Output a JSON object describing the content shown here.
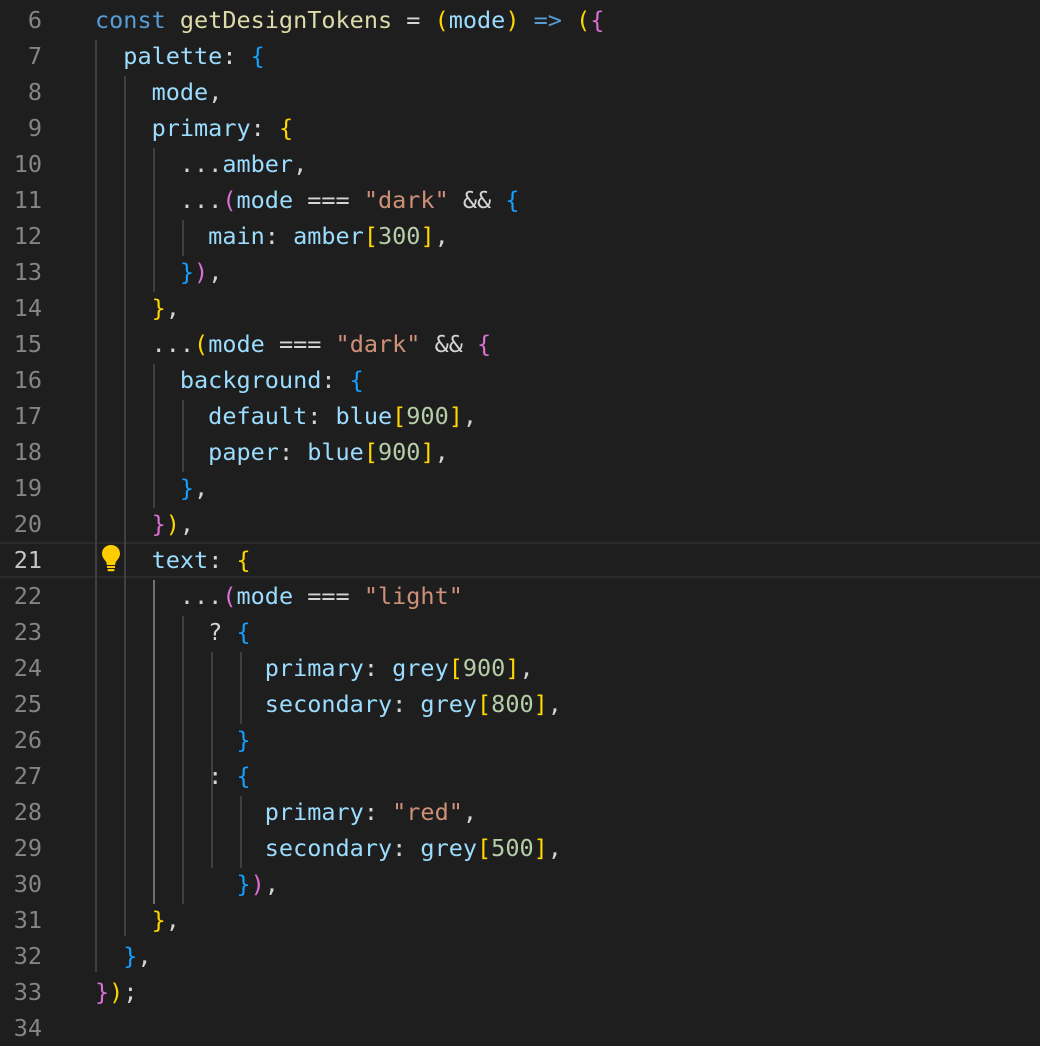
{
  "editor": {
    "current_line": 21,
    "lightbulb_icon": "lightbulb-icon",
    "lines": [
      {
        "n": "6",
        "t": [
          [
            "const ",
            "kw"
          ],
          [
            "getDesignTokens",
            "fn"
          ],
          [
            " = ",
            "op"
          ],
          [
            "(",
            "b1"
          ],
          [
            "mode",
            "var"
          ],
          [
            ")",
            "b1"
          ],
          [
            " => ",
            "kw"
          ],
          [
            "(",
            "b1"
          ],
          [
            "{",
            "b2"
          ]
        ]
      },
      {
        "n": "7",
        "t": [
          [
            "  palette",
            "var"
          ],
          [
            ": ",
            "op"
          ],
          [
            "{",
            "b3"
          ]
        ]
      },
      {
        "n": "8",
        "t": [
          [
            "    mode",
            "var"
          ],
          [
            ",",
            "op"
          ]
        ]
      },
      {
        "n": "9",
        "t": [
          [
            "    primary",
            "var"
          ],
          [
            ": ",
            "op"
          ],
          [
            "{",
            "b1"
          ]
        ]
      },
      {
        "n": "10",
        "t": [
          [
            "      ...",
            "op"
          ],
          [
            "amber",
            "var"
          ],
          [
            ",",
            "op"
          ]
        ]
      },
      {
        "n": "11",
        "t": [
          [
            "      ...",
            "op"
          ],
          [
            "(",
            "b2"
          ],
          [
            "mode",
            "var"
          ],
          [
            " === ",
            "op"
          ],
          [
            "\"dark\"",
            "str"
          ],
          [
            " && ",
            "op"
          ],
          [
            "{",
            "b3"
          ]
        ]
      },
      {
        "n": "12",
        "t": [
          [
            "        main",
            "var"
          ],
          [
            ": ",
            "op"
          ],
          [
            "amber",
            "var"
          ],
          [
            "[",
            "b1"
          ],
          [
            "300",
            "num"
          ],
          [
            "]",
            "b1"
          ],
          [
            ",",
            "op"
          ]
        ]
      },
      {
        "n": "13",
        "t": [
          [
            "      ",
            "op"
          ],
          [
            "}",
            "b3"
          ],
          [
            ")",
            "b2"
          ],
          [
            ",",
            "op"
          ]
        ]
      },
      {
        "n": "14",
        "t": [
          [
            "    ",
            "op"
          ],
          [
            "}",
            "b1"
          ],
          [
            ",",
            "op"
          ]
        ]
      },
      {
        "n": "15",
        "t": [
          [
            "    ...",
            "op"
          ],
          [
            "(",
            "b1"
          ],
          [
            "mode",
            "var"
          ],
          [
            " === ",
            "op"
          ],
          [
            "\"dark\"",
            "str"
          ],
          [
            " && ",
            "op"
          ],
          [
            "{",
            "b2"
          ]
        ]
      },
      {
        "n": "16",
        "t": [
          [
            "      background",
            "var"
          ],
          [
            ": ",
            "op"
          ],
          [
            "{",
            "b3"
          ]
        ]
      },
      {
        "n": "17",
        "t": [
          [
            "        default",
            "var"
          ],
          [
            ": ",
            "op"
          ],
          [
            "blue",
            "var"
          ],
          [
            "[",
            "b1"
          ],
          [
            "900",
            "num"
          ],
          [
            "]",
            "b1"
          ],
          [
            ",",
            "op"
          ]
        ]
      },
      {
        "n": "18",
        "t": [
          [
            "        paper",
            "var"
          ],
          [
            ": ",
            "op"
          ],
          [
            "blue",
            "var"
          ],
          [
            "[",
            "b1"
          ],
          [
            "900",
            "num"
          ],
          [
            "]",
            "b1"
          ],
          [
            ",",
            "op"
          ]
        ]
      },
      {
        "n": "19",
        "t": [
          [
            "      ",
            "op"
          ],
          [
            "}",
            "b3"
          ],
          [
            ",",
            "op"
          ]
        ]
      },
      {
        "n": "20",
        "t": [
          [
            "    ",
            "op"
          ],
          [
            "}",
            "b2"
          ],
          [
            ")",
            "b1"
          ],
          [
            ",",
            "op"
          ]
        ]
      },
      {
        "n": "21",
        "t": [
          [
            "    text",
            "var"
          ],
          [
            ": ",
            "op"
          ],
          [
            "{",
            "b1"
          ]
        ]
      },
      {
        "n": "22",
        "t": [
          [
            "      ...",
            "op"
          ],
          [
            "(",
            "b2"
          ],
          [
            "mode",
            "var"
          ],
          [
            " === ",
            "op"
          ],
          [
            "\"light\"",
            "str"
          ]
        ]
      },
      {
        "n": "23",
        "t": [
          [
            "        ? ",
            "op"
          ],
          [
            "{",
            "b3"
          ]
        ]
      },
      {
        "n": "24",
        "t": [
          [
            "            primary",
            "var"
          ],
          [
            ": ",
            "op"
          ],
          [
            "grey",
            "var"
          ],
          [
            "[",
            "b1"
          ],
          [
            "900",
            "num"
          ],
          [
            "]",
            "b1"
          ],
          [
            ",",
            "op"
          ]
        ]
      },
      {
        "n": "25",
        "t": [
          [
            "            secondary",
            "var"
          ],
          [
            ": ",
            "op"
          ],
          [
            "grey",
            "var"
          ],
          [
            "[",
            "b1"
          ],
          [
            "800",
            "num"
          ],
          [
            "]",
            "b1"
          ],
          [
            ",",
            "op"
          ]
        ]
      },
      {
        "n": "26",
        "t": [
          [
            "          ",
            "op"
          ],
          [
            "}",
            "b3"
          ]
        ]
      },
      {
        "n": "27",
        "t": [
          [
            "        : ",
            "op"
          ],
          [
            "{",
            "b3"
          ]
        ]
      },
      {
        "n": "28",
        "t": [
          [
            "            primary",
            "var"
          ],
          [
            ": ",
            "op"
          ],
          [
            "\"red\"",
            "str"
          ],
          [
            ",",
            "op"
          ]
        ]
      },
      {
        "n": "29",
        "t": [
          [
            "            secondary",
            "var"
          ],
          [
            ": ",
            "op"
          ],
          [
            "grey",
            "var"
          ],
          [
            "[",
            "b1"
          ],
          [
            "500",
            "num"
          ],
          [
            "]",
            "b1"
          ],
          [
            ",",
            "op"
          ]
        ]
      },
      {
        "n": "30",
        "t": [
          [
            "          ",
            "op"
          ],
          [
            "}",
            "b3"
          ],
          [
            ")",
            "b2"
          ],
          [
            ",",
            "op"
          ]
        ]
      },
      {
        "n": "31",
        "t": [
          [
            "    ",
            "op"
          ],
          [
            "}",
            "b1"
          ],
          [
            ",",
            "op"
          ]
        ]
      },
      {
        "n": "32",
        "t": [
          [
            "  ",
            "op"
          ],
          [
            "}",
            "b3"
          ],
          [
            ",",
            "op"
          ]
        ]
      },
      {
        "n": "33",
        "t": [
          [
            "}",
            "b2"
          ],
          [
            ")",
            "b1"
          ],
          [
            ";",
            "op"
          ]
        ]
      },
      {
        "n": "34",
        "t": []
      }
    ]
  }
}
